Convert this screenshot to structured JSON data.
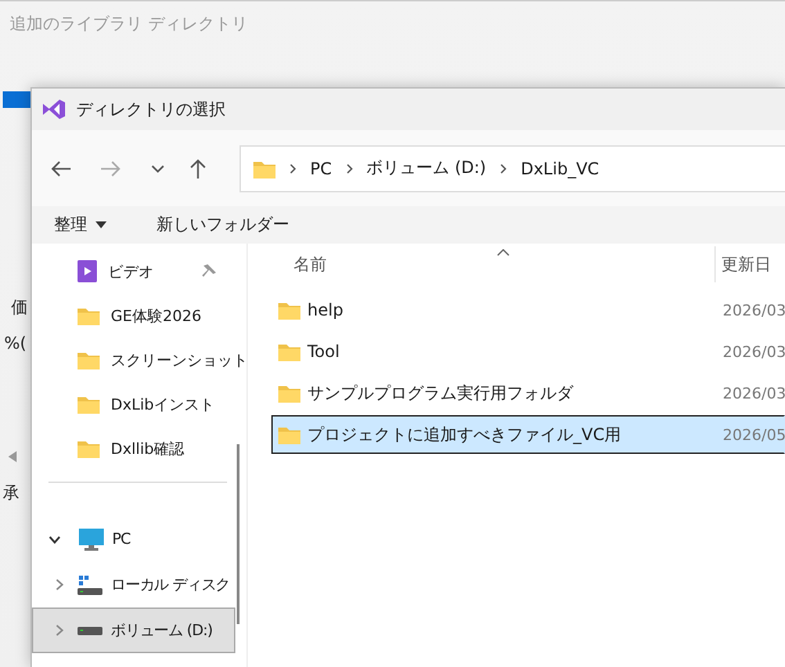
{
  "back_window": {
    "title": "追加のライブラリ ディレクトリ",
    "left_texts": [
      "価",
      "%(",
      "承"
    ]
  },
  "dialog": {
    "title": "ディレクトリの選択",
    "breadcrumb": [
      "PC",
      "ボリューム (D:)",
      "DxLib_VC"
    ],
    "toolbar": {
      "organize": "整理",
      "new_folder": "新しいフォルダー"
    },
    "sidebar": {
      "quick_access": [
        {
          "label": "ビデオ",
          "kind": "video",
          "pinned": true
        },
        {
          "label": "GE体験2026",
          "kind": "folder",
          "pinned": false
        },
        {
          "label": "スクリーンショット",
          "kind": "folder",
          "pinned": false
        },
        {
          "label": "DxLibインスト",
          "kind": "folder",
          "pinned": false
        },
        {
          "label": "Dxllib確認",
          "kind": "folder",
          "pinned": false
        }
      ],
      "tree": [
        {
          "label": "PC",
          "kind": "pc",
          "expanded": true,
          "selected": false,
          "children": [
            {
              "label": "ローカル ディスク",
              "kind": "disk",
              "expanded": false,
              "selected": false
            },
            {
              "label": "ボリューム (D:)",
              "kind": "drive",
              "expanded": false,
              "selected": true
            }
          ]
        }
      ]
    },
    "file_list": {
      "columns": [
        "名前",
        "更新日"
      ],
      "rows": [
        {
          "name": "help",
          "modified": "2026/03",
          "selected": false
        },
        {
          "name": "Tool",
          "modified": "2026/03",
          "selected": false
        },
        {
          "name": "サンプルプログラム実行用フォルダ",
          "modified": "2026/03",
          "selected": false
        },
        {
          "name": "プロジェクトに追加すべきファイル_VC用",
          "modified": "2026/05",
          "selected": true
        }
      ]
    }
  }
}
